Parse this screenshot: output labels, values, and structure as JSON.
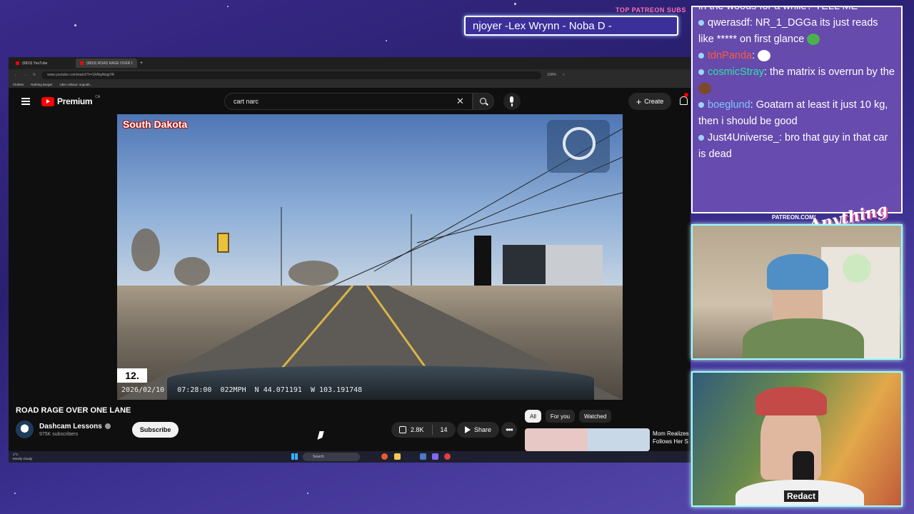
{
  "overlay": {
    "ticker_title": "TOP PATREON SUBS",
    "ticker_text": "njoyer -Lex Wrynn -  Noba D -",
    "patreon_label": "PATREON.COM/",
    "brand": "Anything Else"
  },
  "browser": {
    "tabs": [
      {
        "label": "(6819) YouTube",
        "active": false
      },
      {
        "label": "(6819) ROAD RAGE OVER ONE LANE",
        "active": true
      }
    ],
    "url": "www.youtube.com/watch?v=1lkNqAkqpYA",
    "zoom": "100%",
    "bookmarks": [
      "Clothes",
      "Nothing Burger",
      "Uber Ulisour: supodit..."
    ]
  },
  "youtube": {
    "logo_text": "Premium",
    "country": "CA",
    "search_value": "cart narc",
    "create_label": "Create",
    "video": {
      "location_label": "South Dakota",
      "channel_number": "12.",
      "date": "2026/02/10",
      "time": "07:28:00",
      "speed": "022MPH",
      "lat": "N 44.071191",
      "lon": "W 103.191748"
    },
    "title": "ROAD RAGE OVER ONE LANE",
    "channel_name": "Dashcam Lessons",
    "subscribers": "975K subscribers",
    "subscribe_label": "Subscribe",
    "likes": "2.8K",
    "comments_count": "14",
    "share_label": "Share",
    "chips": [
      "All",
      "For you",
      "Watched"
    ],
    "recommended_title": "Mom Realizes Follows Her S"
  },
  "taskbar": {
    "weather_temp": "1°C",
    "weather_desc": "Mostly cloudy",
    "search_placeholder": "Search"
  },
  "chat": {
    "partial_top": "in the woods for a while? TELL ME",
    "messages": [
      {
        "user": "qwerasdf",
        "user_color": "#ffffff",
        "text": "NR_1_DGGa its just reads like ***** on first glance"
      },
      {
        "user": "tdnPanda",
        "user_color": "#ff5a3c",
        "text": ""
      },
      {
        "user": "cosmicStray",
        "user_color": "#2fe3a8",
        "text": "the matrix is overrun by the"
      },
      {
        "user": "boeglund",
        "user_color": "#7ec9ff",
        "text": "Goatarn at least it just 10 kg, then i should be good"
      },
      {
        "user": "Just4Universe_",
        "user_color": "#ffffff",
        "text": "bro that guy in that car is dead"
      }
    ]
  },
  "cam2_shirt_text": "Redact"
}
